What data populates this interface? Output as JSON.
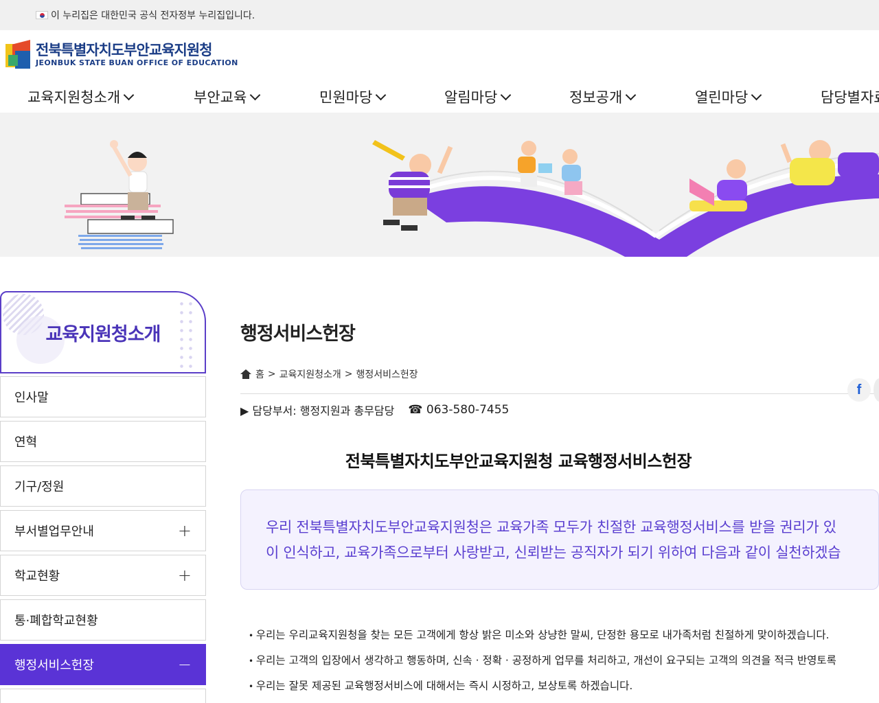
{
  "gov_bar": {
    "text": "이 누리집은 대한민국 공식 전자정부 누리집입니다."
  },
  "logo": {
    "name_kr": "전북특별자치도부안교육지원청",
    "name_en": "JEONBUK STATE BUAN OFFICE OF EDUCATION"
  },
  "gnb": [
    {
      "label": "교육지원청소개"
    },
    {
      "label": "부안교육"
    },
    {
      "label": "민원마당"
    },
    {
      "label": "알림마당"
    },
    {
      "label": "정보공개"
    },
    {
      "label": "열린마당"
    },
    {
      "label": "담당별자료"
    }
  ],
  "lnb": {
    "title": "교육지원청소개",
    "items": [
      {
        "label": "인사말",
        "icon": ""
      },
      {
        "label": "연혁",
        "icon": ""
      },
      {
        "label": "기구/정원",
        "icon": ""
      },
      {
        "label": "부서별업무안내",
        "icon": "+"
      },
      {
        "label": "학교현황",
        "icon": "+"
      },
      {
        "label": "통·폐합학교현황",
        "icon": ""
      },
      {
        "label": "행정서비스헌장",
        "icon": "−"
      }
    ]
  },
  "main": {
    "page_title": "행정서비스헌장",
    "breadcrumb": {
      "home": "홈",
      "level1": "교육지원청소개",
      "level2": "행정서비스헌장",
      "sep": ">"
    },
    "share": {
      "facebook": "f"
    },
    "dept": {
      "label": "▶ 담당부서: 행정지원과 총무담당",
      "tel": "☎ 063-580-7455"
    },
    "doc_title": "전북특별자치도부안교육지원청 교육행정서비스헌장",
    "pledge": [
      "우리 전북특별자치도부안교육지원청은 교육가족 모두가 친절한 교육행정서비스를 받을 권리가 있",
      "이 인식하고, 교육가족으로부터 사랑받고, 신뢰받는 공직자가 되기 위하여 다음과 같이 실천하겠습"
    ],
    "bullets": [
      "우리는 우리교육지원청을 찾는 모든 고객에게 항상 밝은 미소와 상냥한 말씨, 단정한 용모로 내가족처럼 친절하게 맞이하겠습니다.",
      "우리는 고객의 입장에서 생각하고 행동하며, 신속 · 정확 · 공정하게 업무를 처리하고, 개선이 요구되는 고객의 의견을 적극 반영토록",
      "우리는 잘못 제공된 교육행정서비스에 대해서는 즉시 시정하고, 보상토록 하겠습니다."
    ]
  },
  "colors": {
    "accent": "#5a33d6",
    "logo_blue": "#1b3d86",
    "pledge_text": "#5a3fd0"
  }
}
